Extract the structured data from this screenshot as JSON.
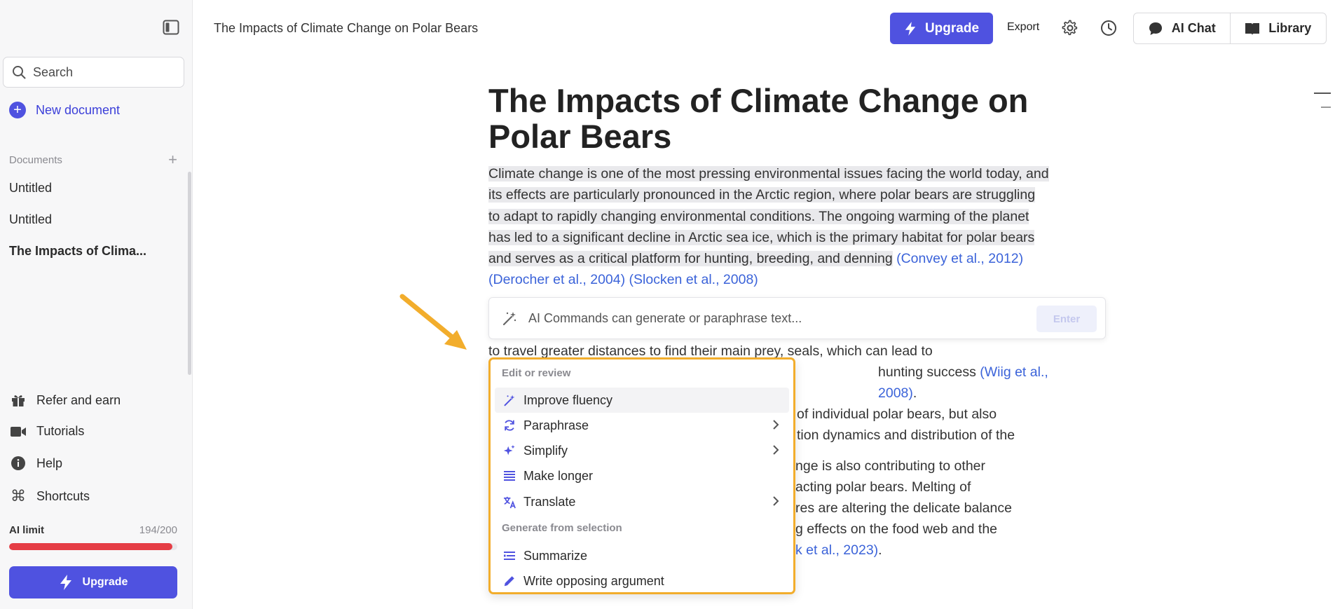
{
  "sidebar": {
    "search_placeholder": "Search",
    "new_document_label": "New document",
    "documents_header": "Documents",
    "documents": [
      "Untitled",
      "Untitled",
      "The Impacts of Clima..."
    ],
    "links": {
      "refer": "Refer and earn",
      "tutorials": "Tutorials",
      "help": "Help",
      "shortcuts": "Shortcuts"
    },
    "ai_limit_label": "AI limit",
    "ai_limit_value": "194/200",
    "ai_limit_used_fraction": 0.97,
    "upgrade_label": "Upgrade"
  },
  "topbar": {
    "doc_title": "The Impacts of Climate Change on Polar Bears",
    "upgrade_label": "Upgrade",
    "export_label": "Export",
    "ai_chat_label": "AI Chat",
    "library_label": "Library"
  },
  "document": {
    "title": "The Impacts of Climate Change on Polar Bears",
    "para1_text": "Climate change is one of the most pressing environmental issues facing the world today, and its effects are particularly pronounced in the Arctic region, where polar bears are struggling to adapt to rapidly changing environmental conditions. The ongoing warming of the planet has led to a significant decline in Arctic sea ice, which is the primary habitat for polar bears and serves as a critical platform for hunting, breeding, and denning",
    "para1_cite1": "(Convey et al., 2012)",
    "para1_cite2": "(Derocher et al., 2004)",
    "para1_cite3": "(Slocken et al., 2008)",
    "para2_line1": "to travel greater distances to find their main prey, seals, which can lead to",
    "para2_line2": "hunting success",
    "para2_cite": "(Wiig et al., 2008)",
    "para2_line3": "of individual polar bears, but also",
    "para2_line4": "tion dynamics and distribution of the",
    "para3_line1": "nge is also contributing to other",
    "para3_line2": "acting polar bears. Melting of",
    "para3_line3": "res are altering the delicate balance",
    "para3_line4": "g effects on the food web and the",
    "para3_cite": "k et al., 2023)"
  },
  "ai_bar": {
    "placeholder": "AI Commands can generate or paraphrase text...",
    "enter_label": "Enter"
  },
  "menu": {
    "section1": "Edit or review",
    "items1": [
      "Improve fluency",
      "Paraphrase",
      "Simplify",
      "Make longer",
      "Translate"
    ],
    "section2": "Generate from selection",
    "items2": [
      "Summarize",
      "Write opposing argument"
    ]
  },
  "colors": {
    "accent": "#4f52e0",
    "highlight_border": "#f2ad2c",
    "limit_bar": "#e53d45",
    "citation": "#3b63d9"
  }
}
